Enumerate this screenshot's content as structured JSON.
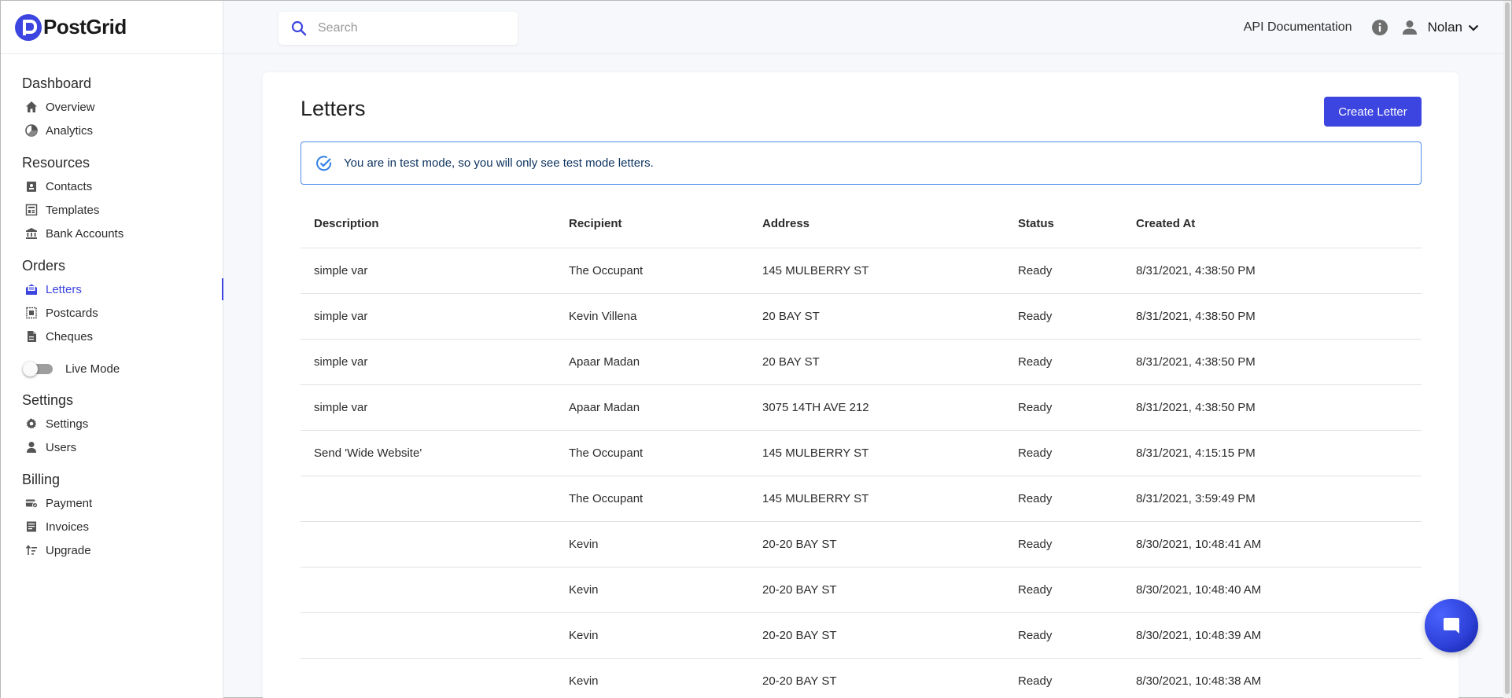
{
  "brand": {
    "name": "PostGrid",
    "color": "#3c45e0"
  },
  "topbar": {
    "search_placeholder": "Search",
    "api_docs_label": "API Documentation",
    "user_name": "Nolan"
  },
  "sidebar": {
    "sections": [
      {
        "title": "Dashboard",
        "items": [
          {
            "label": "Overview",
            "icon": "home-icon"
          },
          {
            "label": "Analytics",
            "icon": "pie-chart-icon"
          }
        ]
      },
      {
        "title": "Resources",
        "items": [
          {
            "label": "Contacts",
            "icon": "contact-card-icon"
          },
          {
            "label": "Templates",
            "icon": "template-icon"
          },
          {
            "label": "Bank Accounts",
            "icon": "bank-icon"
          }
        ]
      },
      {
        "title": "Orders",
        "items": [
          {
            "label": "Letters",
            "icon": "mail-icon",
            "active": true
          },
          {
            "label": "Postcards",
            "icon": "postcard-icon"
          },
          {
            "label": "Cheques",
            "icon": "document-icon"
          }
        ]
      },
      {
        "title": "Settings",
        "items": [
          {
            "label": "Settings",
            "icon": "gear-icon"
          },
          {
            "label": "Users",
            "icon": "user-icon"
          }
        ]
      },
      {
        "title": "Billing",
        "items": [
          {
            "label": "Payment",
            "icon": "payment-icon"
          },
          {
            "label": "Invoices",
            "icon": "invoice-icon"
          },
          {
            "label": "Upgrade",
            "icon": "upgrade-icon"
          }
        ]
      }
    ],
    "live_mode_label": "Live Mode",
    "live_mode_on": false
  },
  "main": {
    "title": "Letters",
    "create_button_label": "Create Letter",
    "alert_text": "You are in test mode, so you will only see test mode letters.",
    "table": {
      "columns": [
        "Description",
        "Recipient",
        "Address",
        "Status",
        "Created At"
      ],
      "rows": [
        [
          "simple var",
          "The Occupant",
          "145 MULBERRY ST",
          "Ready",
          "8/31/2021, 4:38:50 PM"
        ],
        [
          "simple var",
          "Kevin Villena",
          "20 BAY ST",
          "Ready",
          "8/31/2021, 4:38:50 PM"
        ],
        [
          "simple var",
          "Apaar Madan",
          "20 BAY ST",
          "Ready",
          "8/31/2021, 4:38:50 PM"
        ],
        [
          "simple var",
          "Apaar Madan",
          "3075 14TH AVE 212",
          "Ready",
          "8/31/2021, 4:38:50 PM"
        ],
        [
          "Send 'Wide Website'",
          "The Occupant",
          "145 MULBERRY ST",
          "Ready",
          "8/31/2021, 4:15:15 PM"
        ],
        [
          "",
          "The Occupant",
          "145 MULBERRY ST",
          "Ready",
          "8/31/2021, 3:59:49 PM"
        ],
        [
          "",
          "Kevin",
          "20-20 BAY ST",
          "Ready",
          "8/30/2021, 10:48:41 AM"
        ],
        [
          "",
          "Kevin",
          "20-20 BAY ST",
          "Ready",
          "8/30/2021, 10:48:40 AM"
        ],
        [
          "",
          "Kevin",
          "20-20 BAY ST",
          "Ready",
          "8/30/2021, 10:48:39 AM"
        ],
        [
          "",
          "Kevin",
          "20-20 BAY ST",
          "Ready",
          "8/30/2021, 10:48:38 AM"
        ]
      ]
    }
  }
}
